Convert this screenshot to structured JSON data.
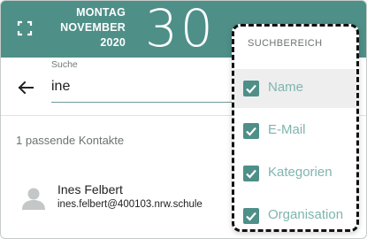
{
  "header": {
    "weekday": "MONTAG",
    "month": "NOVEMBER",
    "year": "2020",
    "day": "30",
    "background_color": "#4e8f88"
  },
  "search": {
    "label": "Suche",
    "value": "ine"
  },
  "results": {
    "count_text": "1 passende Kontakte",
    "contacts": [
      {
        "name": "Ines Felbert",
        "email": "ines.felbert@400103.nrw.schule"
      }
    ]
  },
  "menu": {
    "title": "SUCHBEREICH",
    "items": [
      {
        "label": "Name",
        "checked": true
      },
      {
        "label": "E-Mail",
        "checked": true
      },
      {
        "label": "Kategorien",
        "checked": true
      },
      {
        "label": "Organisation",
        "checked": true
      }
    ],
    "accent_color": "#4e8f88",
    "label_color": "#7fb5af"
  }
}
